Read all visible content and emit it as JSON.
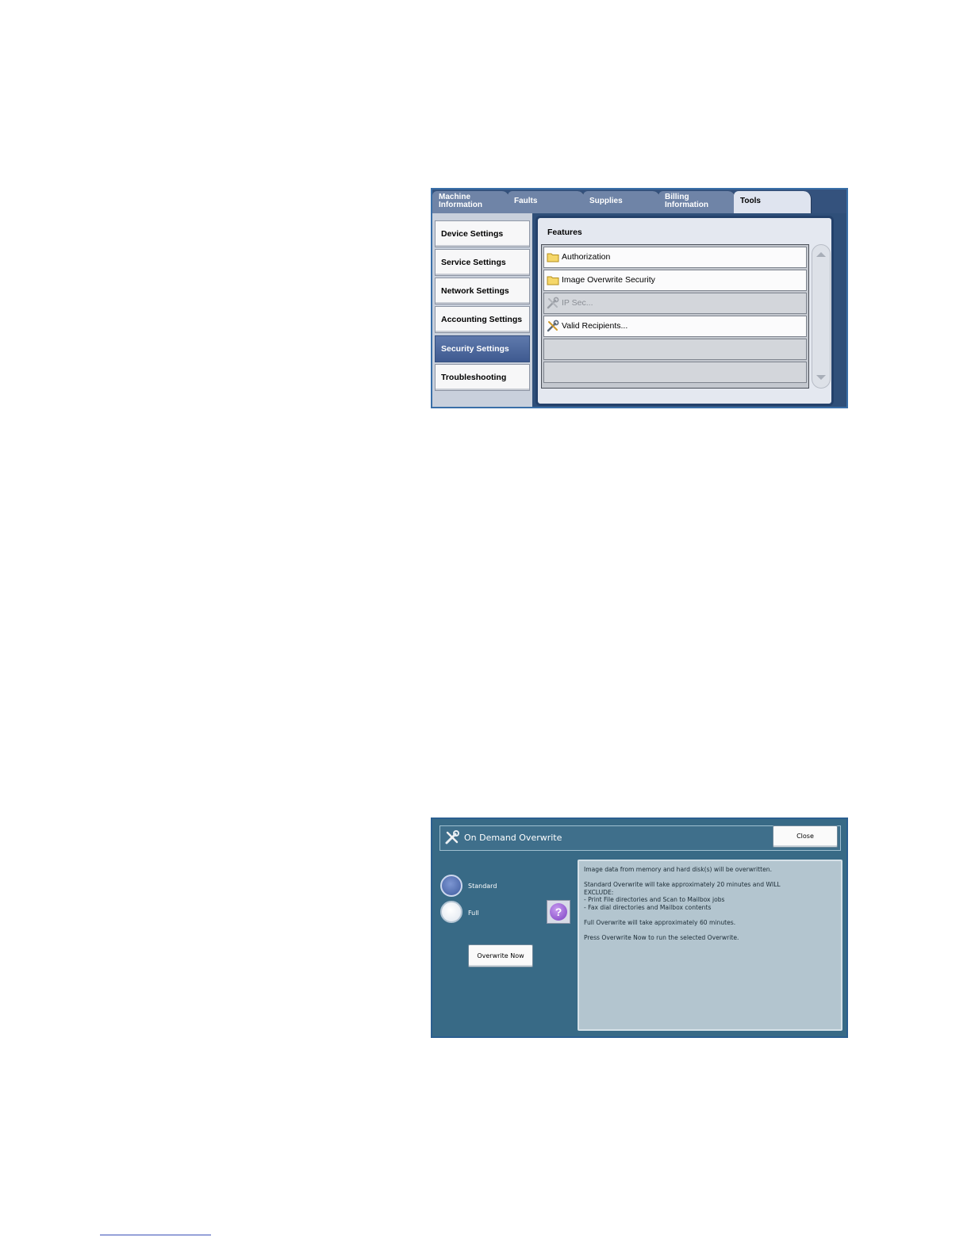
{
  "tools_screen": {
    "tabs": [
      {
        "label": "Machine\nInformation"
      },
      {
        "label": "Faults"
      },
      {
        "label": "Supplies"
      },
      {
        "label": "Billing\nInformation"
      },
      {
        "label": "Tools",
        "active": true
      }
    ],
    "nav_items": [
      {
        "label": "Device Settings"
      },
      {
        "label": "Service Settings"
      },
      {
        "label": "Network Settings"
      },
      {
        "label": "Accounting Settings"
      },
      {
        "label": "Security Settings",
        "selected": true
      },
      {
        "label": "Troubleshooting"
      }
    ],
    "features_title": "Features",
    "features": [
      {
        "label": "Authorization",
        "icon": "folder-icon",
        "state": "enabled"
      },
      {
        "label": "Image Overwrite Security",
        "icon": "folder-icon",
        "state": "enabled"
      },
      {
        "label": "IP Sec...",
        "icon": "tools-icon",
        "state": "disabled"
      },
      {
        "label": "Valid Recipients...",
        "icon": "tools-icon",
        "state": "enabled"
      }
    ]
  },
  "overwrite_dialog": {
    "title": "On Demand Overwrite",
    "close_label": "Close",
    "options": [
      {
        "label": "Standard",
        "selected": true
      },
      {
        "label": "Full",
        "selected": false
      }
    ],
    "overwrite_button": "Overwrite Now",
    "info_lines": {
      "line1": "Image data from memory and hard disk(s) will be overwritten.",
      "line2a": "Standard Overwrite  will take approximately 20 minutes and WILL",
      "line2b": "EXCLUDE:",
      "line2c": "- Print File directories and Scan to Mailbox jobs",
      "line2d": "- Fax dial directories and Mailbox contents",
      "line3": "Full Overwrite   will take approximately 60 minutes.",
      "line4": "Press Overwrite Now   to run the selected Overwrite."
    }
  },
  "colors": {
    "tab_bar": "#34527d",
    "selected_nav": "#4a659c",
    "dialog_bg": "#386a86",
    "info_panel": "#b3c5cf"
  }
}
